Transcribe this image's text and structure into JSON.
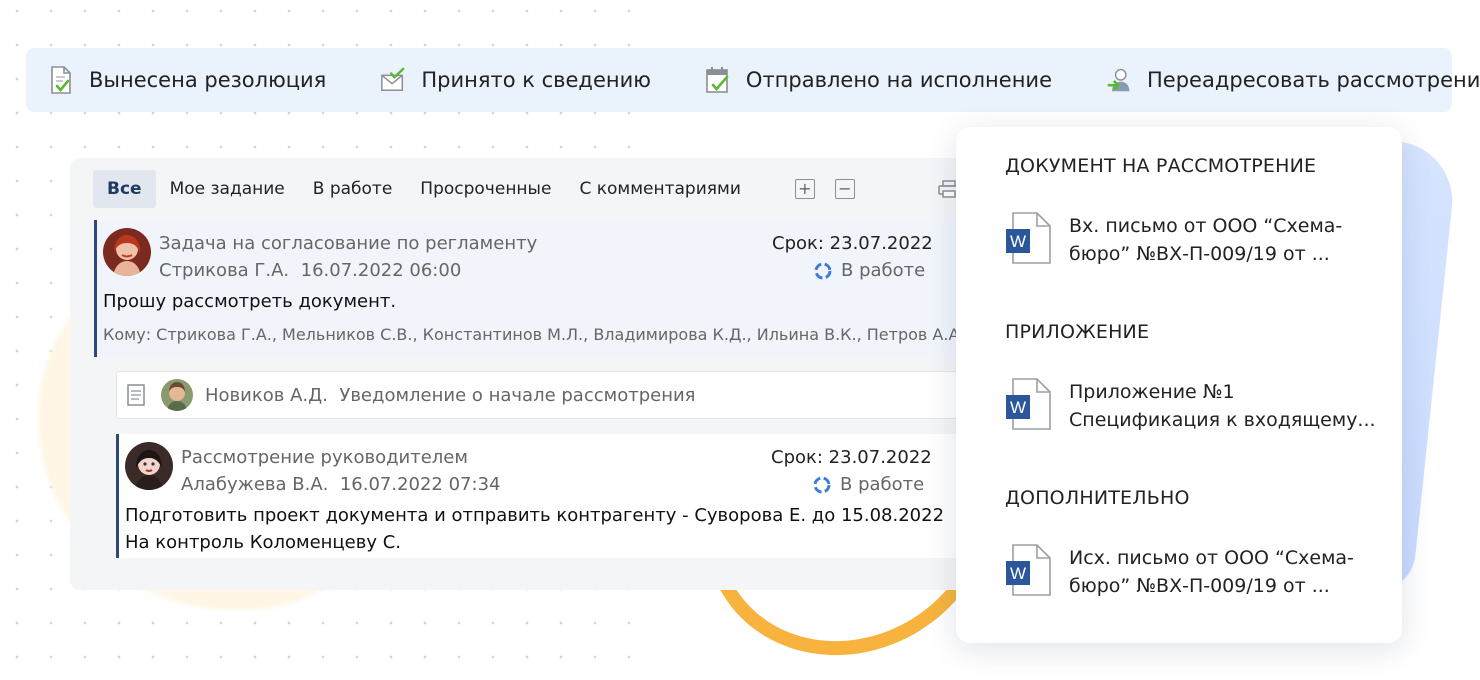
{
  "toolbar": {
    "items": [
      {
        "label": "Вынесена резолюция",
        "icon": "doc-check-icon"
      },
      {
        "label": "Принято к сведению",
        "icon": "envelope-check-icon"
      },
      {
        "label": "Отправлено на исполнение",
        "icon": "calendar-check-icon"
      },
      {
        "label": "Переадресовать рассмотрение",
        "icon": "user-forward-icon"
      }
    ]
  },
  "tabs": [
    "Все",
    "Мое задание",
    "В работе",
    "Просроченные",
    "С комментариями"
  ],
  "active_tab": "Все",
  "tasks": [
    {
      "title": "Задача на согласование по регламенту",
      "author": "Стрикова Г.А.",
      "datetime": "16.07.2022 06:00",
      "due": "Срок: 23.07.2022",
      "status": "В работе",
      "body_lines": [
        "Прошу рассмотреть документ."
      ],
      "recipients": "Кому: Стрикова Г.А., Мельников С.В., Константинов М.Л., Владимирова К.Д., Ильина В.К., Петров А.А.,"
    },
    {
      "author": "Новиков А.Д.",
      "notice": "Уведомление о начале рассмотрения"
    },
    {
      "title": "Рассмотрение руководителем",
      "author": "Алабужева В.А.",
      "datetime": "16.07.2022 07:34",
      "due": "Срок: 23.07.2022",
      "status": "В работе",
      "body_lines": [
        "Подготовить проект документа и отправить контрагенту - Суворова Е. до 15.08.2022",
        "На контроль Коломенцеву С."
      ]
    }
  ],
  "documents": [
    {
      "section": "ДОКУМЕНТ НА РАССМОТРЕНИЕ",
      "lines": [
        "Вх. письмо от ООО “Схема-",
        "бюро” №ВХ-П-009/19 от ..."
      ]
    },
    {
      "section": "ПРИЛОЖЕНИЕ",
      "lines": [
        "Приложение №1",
        "Спецификация к входящему..."
      ]
    },
    {
      "section": "ДОПОЛНИТЕЛЬНО",
      "lines": [
        "Исх. письмо от ООО “Схема-",
        "бюро” №ВХ-П-009/19 от ..."
      ]
    }
  ],
  "colors": {
    "accent": "#2a4a78",
    "toolbar_bg": "#eaf2fb",
    "status_icon": "#3d7bd6",
    "word_blue": "#2b579a"
  }
}
